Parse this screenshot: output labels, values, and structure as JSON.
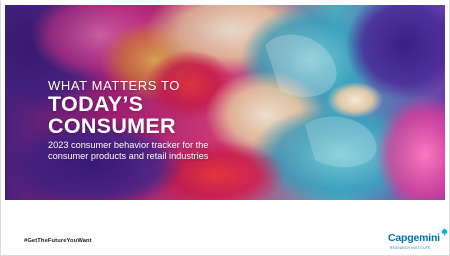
{
  "cover": {
    "kicker": "WHAT MATTERS TO",
    "headline_line1": "TODAY’S",
    "headline_line2": "CONSUMER",
    "subtitle_line1": "2023 consumer behavior tracker for the",
    "subtitle_line2": "consumer products and retail industries"
  },
  "footer": {
    "hashtag": "#GetTheFutureYouWant",
    "logo_text": "Capgemini",
    "logo_tagline": "RESEARCH INSTITUTE"
  },
  "colors": {
    "brand_blue": "#0070ad",
    "magenta": "#e0218a",
    "purple": "#6a2ca0",
    "teal": "#3cb6c9",
    "orange": "#f39a3a"
  }
}
